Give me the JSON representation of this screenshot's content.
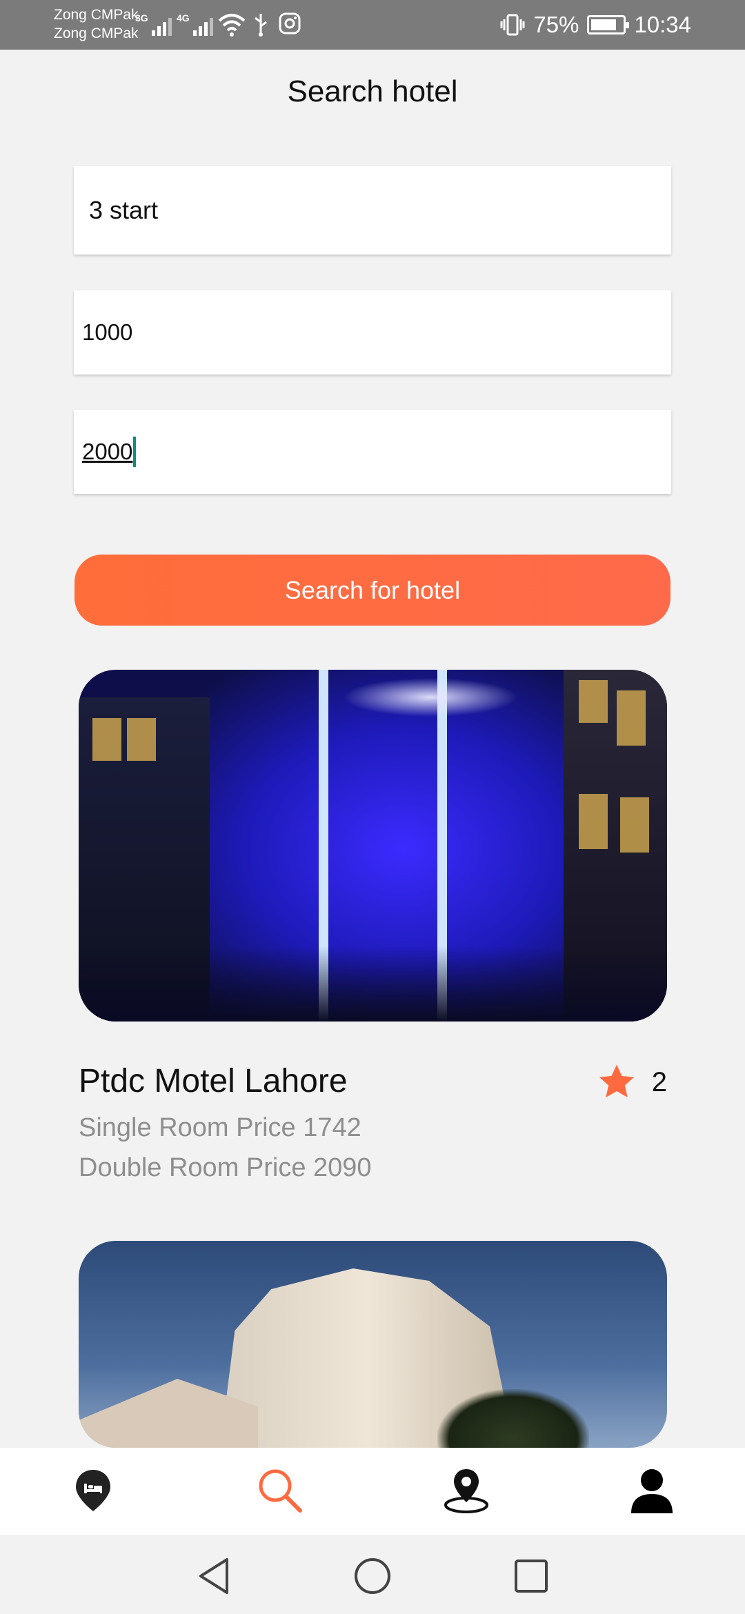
{
  "status_bar": {
    "carrier_1": "Zong CMPak",
    "carrier_2": "Zong CMPak",
    "network_1": "3G",
    "network_2": "4G",
    "battery_percent": "75%",
    "time": "10:34",
    "icons": [
      "signal-icon",
      "signal-icon",
      "wifi-icon",
      "usb-icon",
      "instagram-icon",
      "vibrate-icon",
      "battery-charging-icon"
    ]
  },
  "header": {
    "title": "Search hotel"
  },
  "form": {
    "stars_value": "3 start",
    "min_price_value": "1000",
    "max_price_value": "2000",
    "search_button_label": "Search for hotel"
  },
  "results": [
    {
      "name": "Ptdc Motel Lahore",
      "rating": "2",
      "single_room": "Single Room Price 1742",
      "double_room": "Double Room Price 2090"
    }
  ],
  "bottom_nav": {
    "items": [
      {
        "icon": "hotel-pin-icon",
        "active": false
      },
      {
        "icon": "search-icon",
        "active": true
      },
      {
        "icon": "map-location-icon",
        "active": false
      },
      {
        "icon": "profile-icon",
        "active": false
      }
    ]
  },
  "system_nav": {
    "icons": [
      "back-icon",
      "home-icon",
      "recents-icon"
    ]
  },
  "colors": {
    "accent": "#ff6a40",
    "status_bar": "#7b7b7b",
    "background": "#f2f2f2",
    "secondary_text": "#8e8e8e",
    "caret": "#0b8f7d"
  }
}
